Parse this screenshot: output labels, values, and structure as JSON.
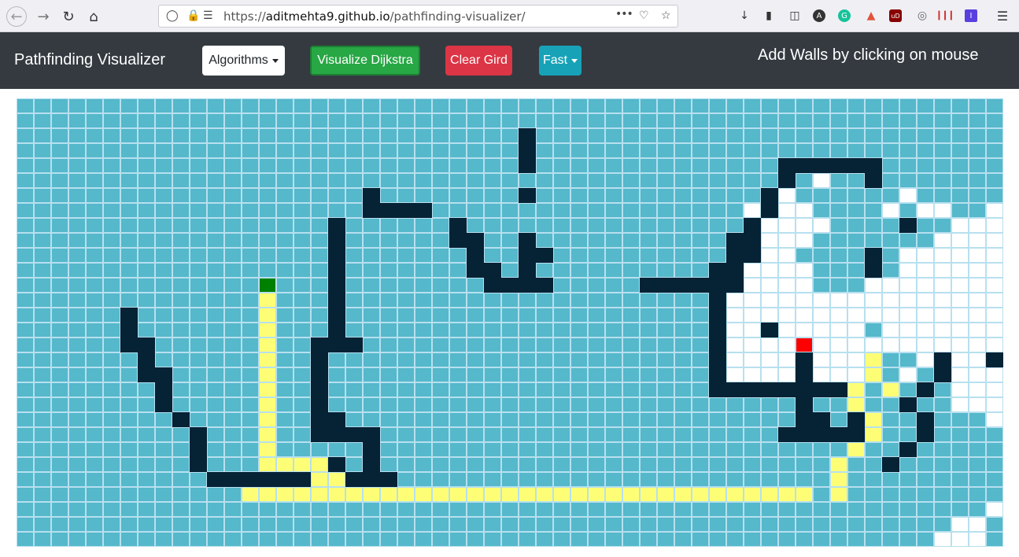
{
  "browser": {
    "url_prefix": "https://",
    "url_host": "aditmehta9.github.io",
    "url_path": "/pathfinding-visualizer/",
    "more_label": "•••"
  },
  "navbar": {
    "brand": "Pathfinding Visualizer",
    "algorithms_label": "Algorithms",
    "visualize_label": "Visualize Dijkstra",
    "clear_label": "Clear Gird",
    "speed_label": "Fast",
    "hint": "Add Walls by clicking on mouse"
  },
  "colors": {
    "navbar": "#343a40",
    "unvisited": "#55b8cb",
    "visited": "#ffffff",
    "wall": "#062235",
    "path": "#fefe76",
    "start": "#008000",
    "target": "#ff0000"
  },
  "grid": {
    "cols": 57,
    "rows": 30,
    "legend": ". unvisited, w wall, p shortest path, u visited, s start, t target",
    "cells": [
      ".........................................................",
      ".........................................................",
      ".............................w...........................",
      ".............................w...........................",
      ".............................w..............wwwwww.......",
      "............................................w.u..w.......",
      "....................w........w.............wu......u.....u",
      "....................wwww..................uwuu....u.uu..u",
      "..................w......w................wuuuu....w..uuu",
      "..................w......ww..w...........wwuuu.......uuuu",
      "..................w.......w..ww..........wwuu....w.uuuuuu",
      "..................w.......ww.w..........wwuuuu...w.uuuuuu",
      "..............s...w........wwww.....wwwwwwuuuu...uuuuuuuu",
      "..............p...w.....................wuuuuuuuuuuuuuuuuw",
      "......w.......p...w.....................wuuuuuuuuuuuuuuuuw",
      "......w.......p...w.....................wuuwuuuuu.uuuuuuuu",
      "......ww......p..www....................wuuuuuuuuuuuuuuuu",
      ".......w......p..w......................wuuuuwuuup..uwuuwwu",
      ".......ww.....p..w......................wuuuuwuuup.u.wuuuu",
      "........w.....p..w......................wwwwwwwwp.p.w.uuuu",
      "........w.....p..w...........................w..p..w..uuuu",
      ".........w....p..ww..........................ww.wp..w...uuu",
      "..........w...p..wwww.......................wwwwwp..w....uu",
      "..........w...p.....w...........................p..w.....u",
      "..........w...ppppw.w..........................p..w.......",
      "...........wwwwwwppwww.........................p..........",
      ".............ppppppppppppppppppppppppppppppppp.p.........",
      "........................................................u",
      "......................................................uu",
      ".....................................................uuu"
    ]
  }
}
